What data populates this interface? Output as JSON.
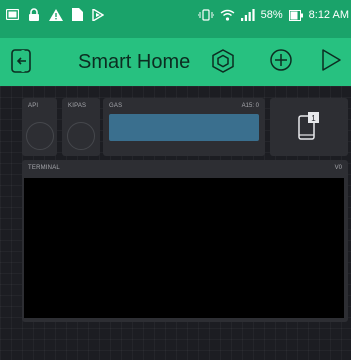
{
  "status_bar": {
    "battery_percent": "58%",
    "time": "8:12 AM",
    "icons": [
      "gallery-icon",
      "lock-icon",
      "warning-icon",
      "file-icon",
      "play-store-icon",
      "vibrate-icon",
      "wifi-icon",
      "signal-icon",
      "battery-icon"
    ]
  },
  "app_bar": {
    "title": "Smart Home",
    "icons": [
      "exit-icon",
      "settings-hex-icon",
      "add-widget-icon",
      "play-icon"
    ]
  },
  "widgets": {
    "api": {
      "label": "API"
    },
    "kipas": {
      "label": "KIPAS"
    },
    "gas": {
      "label": "GAS",
      "value": "A15: 0"
    },
    "device": {
      "icon": "device-notification-icon",
      "badge": "1"
    },
    "terminal": {
      "label": "TERMINAL",
      "pin": "V0"
    }
  },
  "colors": {
    "status_bar": "#1aa36a",
    "app_bar": "#27c180",
    "background": "#1c1d22",
    "widget": "#2d2e33",
    "gas_bar": "#3a6f8e",
    "terminal": "#000000"
  }
}
